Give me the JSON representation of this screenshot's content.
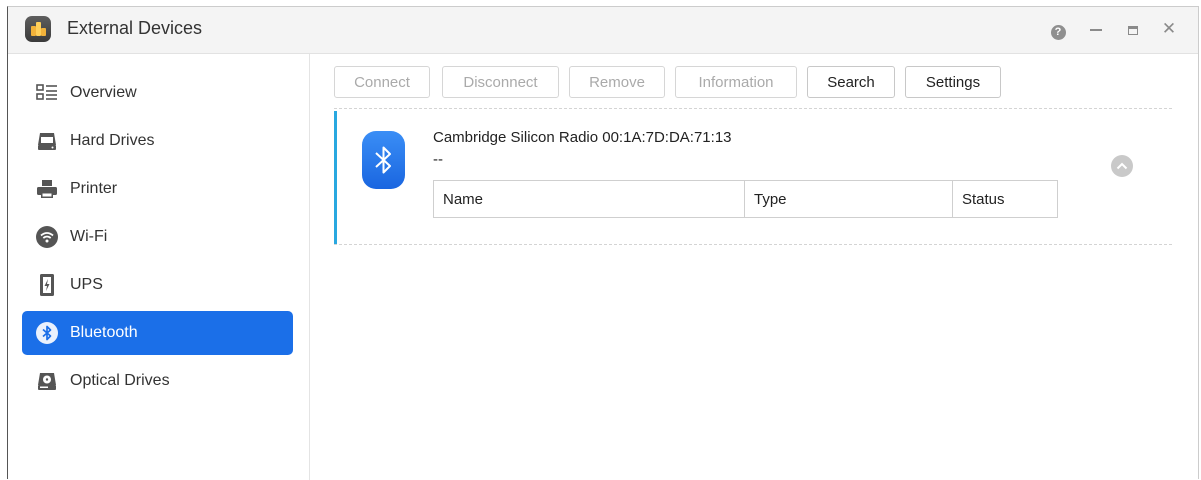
{
  "window": {
    "title": "External Devices",
    "controls": [
      "help-icon",
      "minimize-icon",
      "maximize-icon",
      "close-icon"
    ],
    "close_glyph": "✕",
    "help_glyph": "?"
  },
  "sidebar": {
    "active_color": "#1b6fe8",
    "items": [
      {
        "label": "Overview",
        "icon": "overview-icon",
        "active": false
      },
      {
        "label": "Hard Drives",
        "icon": "hard-drive-icon",
        "active": false
      },
      {
        "label": "Printer",
        "icon": "printer-icon",
        "active": false
      },
      {
        "label": "Wi-Fi",
        "icon": "wifi-icon",
        "active": false
      },
      {
        "label": "UPS",
        "icon": "ups-icon",
        "active": false
      },
      {
        "label": "Bluetooth",
        "icon": "bluetooth-icon",
        "active": true
      },
      {
        "label": "Optical Drives",
        "icon": "optical-drive-icon",
        "active": false
      }
    ]
  },
  "toolbar": {
    "connect": "Connect",
    "disconnect": "Disconnect",
    "remove": "Remove",
    "information": "Information",
    "search": "Search",
    "settings": "Settings",
    "disabled": [
      "Connect",
      "Disconnect",
      "Remove",
      "Information"
    ]
  },
  "device": {
    "name": "Cambridge Silicon Radio 00:1A:7D:DA:71:13",
    "subtitle": "--",
    "accent_color": "#29a8e0",
    "icon": "bluetooth-icon",
    "table": {
      "columns": [
        "Name",
        "Type",
        "Status"
      ]
    }
  }
}
